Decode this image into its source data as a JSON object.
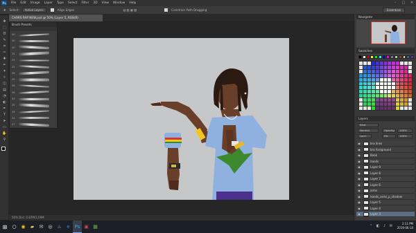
{
  "app": {
    "logo": "Ps",
    "menu": [
      "File",
      "Edit",
      "Image",
      "Layer",
      "Type",
      "Select",
      "Filter",
      "3D",
      "View",
      "Window",
      "Help"
    ],
    "window_controls": [
      "–",
      "□",
      "×"
    ]
  },
  "options_bar": {
    "select_label": "Select:",
    "select_value": "Active Layers",
    "align_label": "Align Edges",
    "constrain_label": "Constrain Path Dragging",
    "workspace": "Essentials"
  },
  "document": {
    "tab_title": "CHARS RAP NEW.psd @ 50% (Layer 5, RGB/8)",
    "status": "50%        Doc: 2.87M/1.09M"
  },
  "toolbar": {
    "tools": [
      "move-tool",
      "marquee-tool",
      "lasso-tool",
      "quick-select-tool",
      "crop-tool",
      "eyedropper-tool",
      "healing-tool",
      "brush-tool",
      "clone-tool",
      "history-brush-tool",
      "eraser-tool",
      "gradient-tool",
      "blur-tool",
      "dodge-tool",
      "pen-tool",
      "type-tool",
      "path-select-tool",
      "shape-tool",
      "hand-tool",
      "zoom-tool"
    ],
    "glyphs": [
      "✥",
      "⬚",
      "ʘ",
      "✎",
      "⌗",
      "✑",
      "✚",
      "✏",
      "✦",
      "✧",
      "◫",
      "▤",
      "◔",
      "◐",
      "✒",
      "T",
      "➤",
      "▭",
      "✋",
      "⚲"
    ]
  },
  "brush_panel": {
    "title": "Brush Presets",
    "sizes": [
      "30",
      "30",
      "30",
      "25",
      "25",
      "25",
      "36",
      "25",
      "36",
      "36",
      "32",
      "25",
      "14",
      "24",
      "27"
    ]
  },
  "navigator": {
    "title": "Navigator"
  },
  "swatches": {
    "title": "Swatches",
    "top_row": [
      "#000000",
      "#ffffff",
      "#ff0000",
      "#ffff00",
      "#00ff00",
      "#00ffff",
      "#0000ff",
      "#ff00ff",
      "#808080",
      "#c0c0c0",
      "#7a4b2a",
      "#ffcc99",
      "#336699",
      "#663399"
    ]
  },
  "layers": {
    "title": "Layers",
    "kind_label": "Kind",
    "blend_mode": "Normal",
    "opacity_label": "Opacity:",
    "opacity_value": "100%",
    "lock_label": "Lock:",
    "fill_label": "Fill:",
    "fill_value": "100%",
    "rows": [
      {
        "name": "bra lines",
        "selected": false
      },
      {
        "name": "bra foreground",
        "selected": false
      },
      {
        "name": "Book",
        "selected": false
      },
      {
        "name": "hands",
        "selected": false
      },
      {
        "name": "Layer 9",
        "selected": false
      },
      {
        "name": "Layer 8",
        "selected": false
      },
      {
        "name": "Layer 7",
        "selected": false
      },
      {
        "name": "Layer 6",
        "selected": false
      },
      {
        "name": "arms",
        "selected": false
      },
      {
        "name": "hands_arms_p_shadow",
        "selected": false
      },
      {
        "name": "Layer 5",
        "selected": false
      },
      {
        "name": "Layer 4",
        "selected": false
      },
      {
        "name": "Layer 3",
        "selected": true
      }
    ]
  },
  "taskbar": {
    "icons": [
      {
        "name": "search-taskbar-icon",
        "glyph": "○",
        "color": "#ffffff"
      },
      {
        "name": "chrome-taskbar-icon",
        "glyph": "◉",
        "color": "#f2c12e"
      },
      {
        "name": "file-explorer-taskbar-icon",
        "glyph": "▰",
        "color": "#f0c05a"
      },
      {
        "name": "mail-taskbar-icon",
        "glyph": "✉",
        "color": "#d0d0d0"
      },
      {
        "name": "media-taskbar-icon",
        "glyph": "◎",
        "color": "#e0e0e0"
      },
      {
        "name": "steam-taskbar-icon",
        "glyph": "♨",
        "color": "#aab8c8"
      },
      {
        "name": "edge-taskbar-icon",
        "glyph": "e",
        "color": "#3c8ad9"
      },
      {
        "name": "photoshop-taskbar-icon",
        "glyph": "Ps",
        "color": "#31a8ff"
      },
      {
        "name": "app-taskbar-icon",
        "glyph": "▣",
        "color": "#c24949"
      },
      {
        "name": "app2-taskbar-icon",
        "glyph": "▦",
        "color": "#6ab04c"
      }
    ],
    "time": "2:11 PM",
    "date": "2019-06-10"
  },
  "colors": {
    "canvas_bg": "#c6c7c9",
    "shirt": "#8fb1df",
    "skin": "#6a3f2a",
    "hair": "#2a1a12",
    "leaf": "#3d8a2e"
  }
}
